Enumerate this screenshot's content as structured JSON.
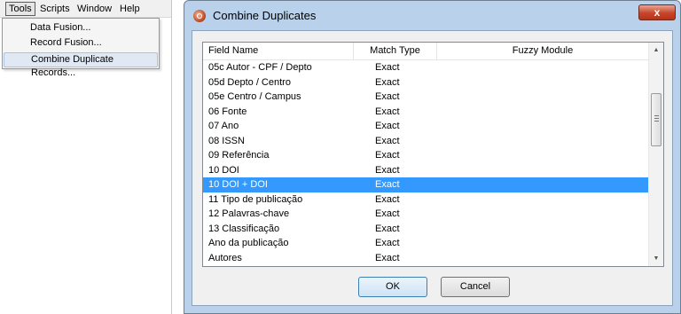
{
  "menubar": {
    "items": [
      "Tools",
      "Scripts",
      "Window",
      "Help"
    ]
  },
  "tools_menu": {
    "items": [
      "Data Fusion...",
      "Record Fusion...",
      "Combine Duplicate Records..."
    ]
  },
  "dialog": {
    "title": "Combine Duplicates",
    "close_glyph": "x",
    "columns": [
      "Field Name",
      "Match Type",
      "Fuzzy Module"
    ],
    "rows": [
      {
        "field": "05c Autor - CPF / Depto",
        "match": "Exact",
        "fuzzy": ""
      },
      {
        "field": "05d Depto / Centro",
        "match": "Exact",
        "fuzzy": ""
      },
      {
        "field": "05e Centro / Campus",
        "match": "Exact",
        "fuzzy": ""
      },
      {
        "field": "06 Fonte",
        "match": "Exact",
        "fuzzy": ""
      },
      {
        "field": "07 Ano",
        "match": "Exact",
        "fuzzy": ""
      },
      {
        "field": "08 ISSN",
        "match": "Exact",
        "fuzzy": ""
      },
      {
        "field": "09 Referência",
        "match": "Exact",
        "fuzzy": ""
      },
      {
        "field": "10 DOI",
        "match": "Exact",
        "fuzzy": ""
      },
      {
        "field": "10 DOI + DOI",
        "match": "Exact",
        "fuzzy": ""
      },
      {
        "field": "11 Tipo de publicação",
        "match": "Exact",
        "fuzzy": ""
      },
      {
        "field": "12 Palavras-chave",
        "match": "Exact",
        "fuzzy": ""
      },
      {
        "field": "13 Classificação",
        "match": "Exact",
        "fuzzy": ""
      },
      {
        "field": "Ano da publicação",
        "match": "Exact",
        "fuzzy": ""
      },
      {
        "field": "Autores",
        "match": "Exact",
        "fuzzy": ""
      }
    ],
    "selected_row": 8,
    "ok_label": "OK",
    "cancel_label": "Cancel"
  },
  "colors": {
    "selection": "#3399ff",
    "dialog_frame": "#b9d1ea",
    "close_button": "#c7452a"
  }
}
